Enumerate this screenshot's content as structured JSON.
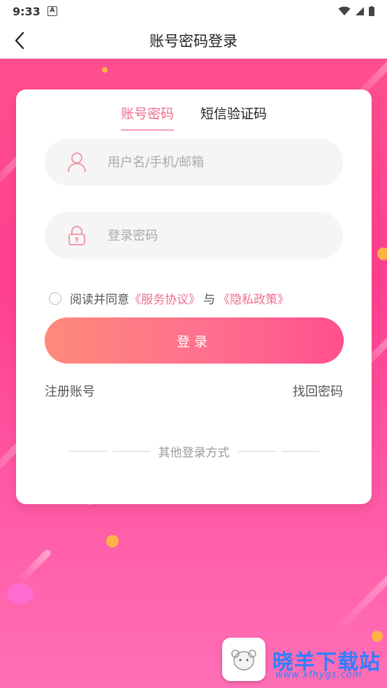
{
  "status_bar": {
    "time": "9:33",
    "notification_letter": "A"
  },
  "header": {
    "title": "账号密码登录"
  },
  "tabs": [
    {
      "label": "账号密码",
      "active": true
    },
    {
      "label": "短信验证码",
      "active": false
    }
  ],
  "form": {
    "username": {
      "placeholder": "用户名/手机/邮箱",
      "value": ""
    },
    "password": {
      "placeholder": "登录密码",
      "value": ""
    }
  },
  "agreement": {
    "prefix": "阅读并同意",
    "service_link": "《服务协议》",
    "joiner": "与",
    "privacy_link": "《隐私政策》",
    "checked": false
  },
  "login_button": {
    "label": "登录"
  },
  "links": {
    "register": "注册账号",
    "forgot_password": "找回密码"
  },
  "other_login": {
    "label": "其他登录方式"
  },
  "watermark": {
    "title": "晓羊下载站",
    "url": "www.xfhygs.com"
  },
  "colors": {
    "accent": "#f06d8f",
    "gradient_start": "#ff8a7a",
    "gradient_end": "#ff4f8f",
    "background": "#ff4f8f"
  }
}
